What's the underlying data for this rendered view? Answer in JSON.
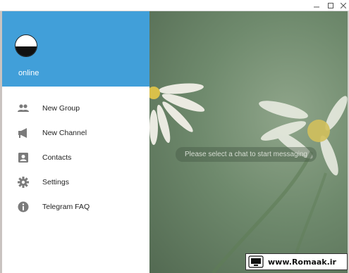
{
  "window": {
    "controls": [
      "minimize-icon",
      "maximize-icon",
      "close-icon"
    ]
  },
  "drawer": {
    "status": "online",
    "header_color": "#419fd9",
    "menu": [
      {
        "label": "New Group",
        "icon": "group-icon"
      },
      {
        "label": "New Channel",
        "icon": "megaphone-icon"
      },
      {
        "label": "Contacts",
        "icon": "contact-card-icon"
      },
      {
        "label": "Settings",
        "icon": "gear-icon"
      },
      {
        "label": "Telegram FAQ",
        "icon": "info-icon"
      }
    ]
  },
  "chat": {
    "empty_message": "Please select a chat to start messaging"
  },
  "watermark": {
    "text": "www.Romaak.ir"
  }
}
